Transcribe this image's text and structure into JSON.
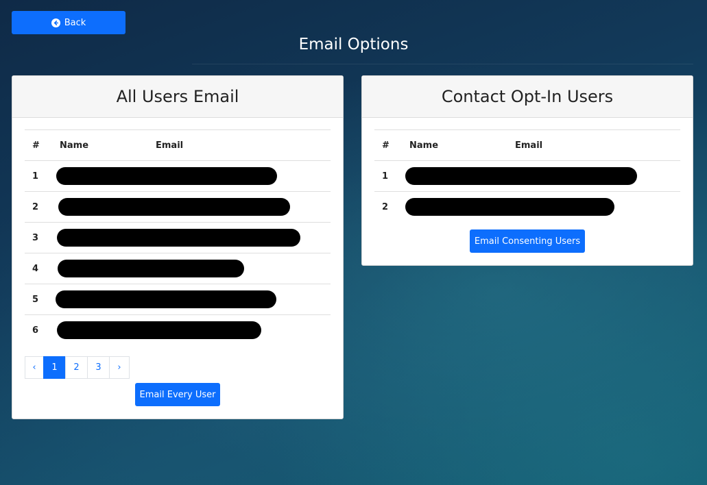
{
  "back_button": {
    "label": "Back",
    "icon": "arrow-circle-left-icon"
  },
  "page_title": "Email Options",
  "all_users": {
    "title": "All Users Email",
    "columns": [
      "#",
      "Name",
      "Email"
    ],
    "rows": [
      {
        "num": "1"
      },
      {
        "num": "2"
      },
      {
        "num": "3"
      },
      {
        "num": "4"
      },
      {
        "num": "5"
      },
      {
        "num": "6"
      }
    ],
    "pagination": {
      "prev": "‹",
      "pages": [
        "1",
        "2",
        "3"
      ],
      "next": "›",
      "active": "1"
    },
    "action_label": "Email Every User"
  },
  "opt_in": {
    "title": "Contact Opt-In Users",
    "columns": [
      "#",
      "Name",
      "Email"
    ],
    "rows": [
      {
        "num": "1"
      },
      {
        "num": "2"
      }
    ],
    "action_label": "Email Consenting Users"
  },
  "colors": {
    "primary": "#0d6efd",
    "redaction": "#000000"
  }
}
